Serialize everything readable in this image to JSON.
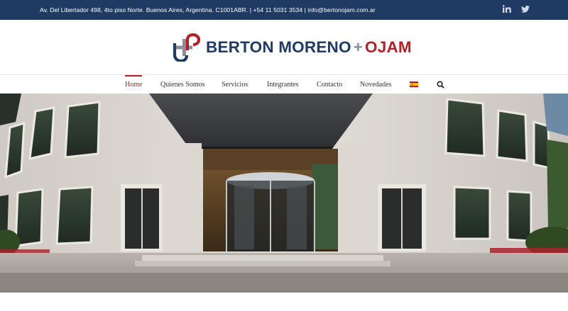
{
  "topbar": {
    "contact_text": "Av. Del Libertador 498, 4to piso Norte. Buenos Aires, Argentina. C1001ABR. | +54 11 5031 3534  |  info@bertonojam.com.ar",
    "social": [
      {
        "icon": "linkedin-icon",
        "label": "in"
      },
      {
        "icon": "twitter-icon"
      }
    ],
    "colors": {
      "background": "#1f3b63",
      "text": "#ffffff"
    }
  },
  "header": {
    "brand_primary": "BERTON MORENO",
    "brand_separator": "+",
    "brand_secondary": "OJAM",
    "colors": {
      "navy": "#1f3b63",
      "red": "#b3202a",
      "grey": "#8a8f96"
    }
  },
  "nav": {
    "items": [
      {
        "label": "Home",
        "active": true
      },
      {
        "label": "Quienes Somos",
        "active": false
      },
      {
        "label": "Servicios",
        "active": false
      },
      {
        "label": "Integrantes",
        "active": false
      },
      {
        "label": "Contacto",
        "active": false
      },
      {
        "label": "Novedades",
        "active": false
      }
    ],
    "language_icon": "spanish-flag-icon",
    "search_icon": "search-icon",
    "active_color": "#b3202a"
  },
  "hero": {
    "image": "building-entrance-photo"
  }
}
